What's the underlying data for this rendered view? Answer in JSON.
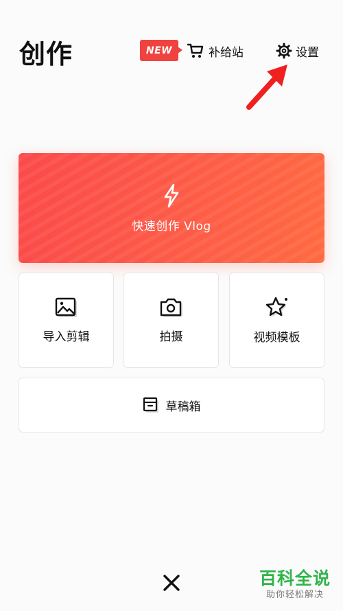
{
  "header": {
    "title": "创作",
    "new_badge": "NEW",
    "supply_label": "补给站",
    "settings_label": "设置"
  },
  "main": {
    "vlog_label": "快速创作 Vlog",
    "tiles": [
      {
        "label": "导入剪辑",
        "icon": "image-icon"
      },
      {
        "label": "拍摄",
        "icon": "camera-icon"
      },
      {
        "label": "视频模板",
        "icon": "star-icon"
      }
    ],
    "drafts_label": "草稿箱"
  },
  "watermark": {
    "title": "百科全说",
    "subtitle": "助你轻松解决"
  },
  "colors": {
    "accent": "#fb4a4a",
    "accent_end": "#ff6a41",
    "annotation": "#f02020",
    "watermark": "#2fb44a"
  }
}
